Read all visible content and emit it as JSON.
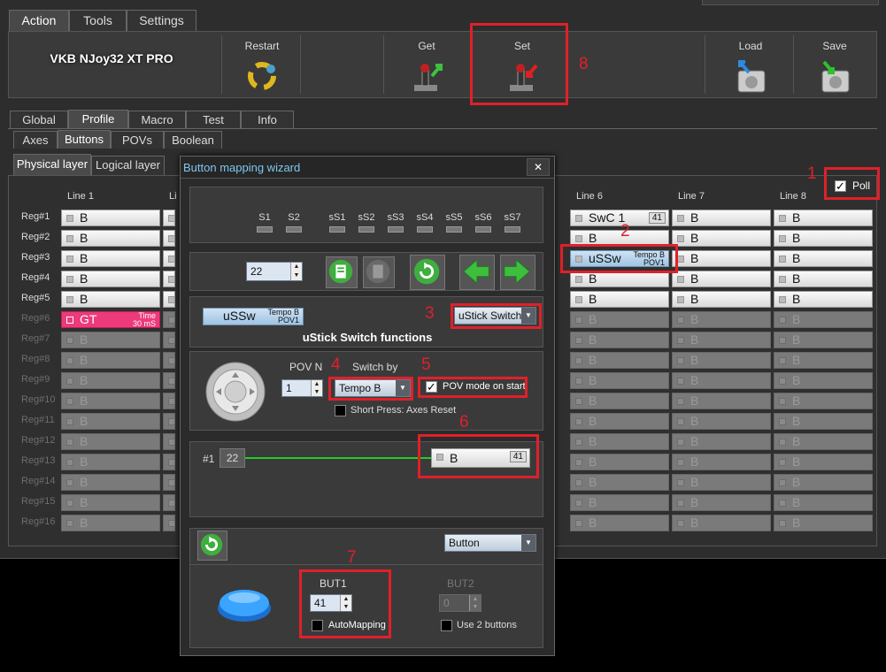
{
  "main_tabs": [
    "Action",
    "Tools",
    "Settings"
  ],
  "device_name": "VKB NJoy32 XT PRO",
  "ribbon": {
    "restart": "Restart",
    "get": "Get",
    "set": "Set",
    "load": "Load",
    "save": "Save"
  },
  "profile_tabs": [
    "Global",
    "Profile",
    "Macro",
    "Test",
    "Info"
  ],
  "sub_tabs": [
    "Axes",
    "Buttons",
    "POVs",
    "Boolean"
  ],
  "layer_tabs": [
    "Physical layer",
    "Logical layer"
  ],
  "poll_label": "Poll",
  "annotations": [
    "1",
    "2",
    "3",
    "4",
    "5",
    "6",
    "7",
    "8"
  ],
  "columns": [
    "Line 1",
    "Li",
    "Line 6",
    "Line 7",
    "Line 8"
  ],
  "rows": [
    "Reg#1",
    "Reg#2",
    "Reg#3",
    "Reg#4",
    "Reg#5",
    "Reg#6",
    "Reg#7",
    "Reg#8",
    "Reg#9",
    "Reg#10",
    "Reg#11",
    "Reg#12",
    "Reg#13",
    "Reg#14",
    "Reg#15",
    "Reg#16"
  ],
  "cell_default": "B",
  "cell_gt": {
    "text": "GT",
    "top": "Time",
    "bottom": "30 mS"
  },
  "cell_swc": {
    "text": "SwC  1",
    "badge": "41"
  },
  "cell_ussw": {
    "text": "uSSw",
    "top": "Tempo B",
    "bottom": "POV1"
  },
  "wizard": {
    "title": "Button mapping wizard",
    "close": "✕",
    "switch_labels": [
      "S1",
      "S2",
      "sS1",
      "sS2",
      "sS3",
      "sS4",
      "sS5",
      "sS6",
      "sS7"
    ],
    "register_value": "22",
    "preview": {
      "text": "uSSw",
      "top": "Tempo B",
      "bottom": "POV1"
    },
    "function_combo": "uStick Switch",
    "section_title": "uStick Switch functions",
    "pov_n_label": "POV N",
    "pov_n_value": "1",
    "switch_by_label": "Switch by",
    "switch_by_value": "Tempo B",
    "pov_mode_label": "POV mode on start",
    "short_press_label": "Short Press: Axes Reset",
    "chain_index": "#1",
    "chain_value": "22",
    "chain_target": {
      "text": "B",
      "badge": "41"
    },
    "output_type": "Button",
    "but1_label": "BUT1",
    "but1_value": "41",
    "but2_label": "BUT2",
    "but2_value": "0",
    "automapping_label": "AutoMapping",
    "use2_label": "Use 2 buttons"
  }
}
